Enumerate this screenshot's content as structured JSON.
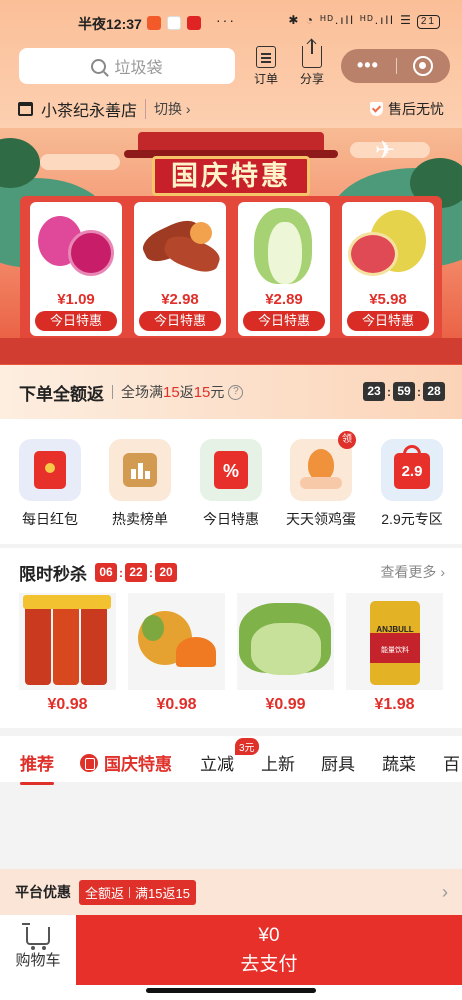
{
  "status": {
    "time": "半夜12:37",
    "dots": "···",
    "sys": "✱ ◔ ᴴᴰ.ıll ᴴᴰ.ıll ☰",
    "battery": "21"
  },
  "header": {
    "search_placeholder": "垃圾袋",
    "orders_label": "订单",
    "share_label": "分享",
    "more_label": "•••"
  },
  "store": {
    "name": "小茶纪永善店",
    "switch_label": "切换 ›",
    "after_sale": "售后无忧"
  },
  "banner": {
    "title": "国庆特惠",
    "deals": [
      {
        "price": "¥1.09",
        "tag": "今日特惠"
      },
      {
        "price": "¥2.98",
        "tag": "今日特惠"
      },
      {
        "price": "¥2.89",
        "tag": "今日特惠"
      },
      {
        "price": "¥5.98",
        "tag": "今日特惠"
      }
    ]
  },
  "promo": {
    "title": "下单全额返",
    "desc_prefix": "全场满",
    "desc_a": "15",
    "desc_mid": "返",
    "desc_b": "15",
    "desc_suffix": "元",
    "help": "?",
    "countdown": [
      "23",
      "59",
      "28"
    ],
    "sep": ":"
  },
  "categories": [
    {
      "label": "每日红包",
      "icon": "red-envelope-icon"
    },
    {
      "label": "热卖榜单",
      "icon": "ranking-icon"
    },
    {
      "label": "今日特惠",
      "icon": "discount-tag-icon"
    },
    {
      "label": "天天领鸡蛋",
      "icon": "egg-icon",
      "badge": "领"
    },
    {
      "label": "2.9元专区",
      "icon": "shopping-bag-icon",
      "icon_text": "2.9"
    }
  ],
  "flash": {
    "title": "限时秒杀",
    "countdown": [
      "06",
      "22",
      "20"
    ],
    "sep": ":",
    "more": "查看更多 ›",
    "items": [
      {
        "price": "¥0.98",
        "name": "spicy-snack-packs"
      },
      {
        "price": "¥0.98",
        "name": "oranges"
      },
      {
        "price": "¥0.99",
        "name": "lettuce"
      },
      {
        "price": "¥1.98",
        "name": "energy-drink",
        "brand": "ANJBULL",
        "brand_cn": "能量饮料"
      }
    ]
  },
  "tabs": [
    {
      "label": "推荐",
      "active": true
    },
    {
      "label": "国庆特惠"
    },
    {
      "label": "立减",
      "badge": "3元"
    },
    {
      "label": "上新"
    },
    {
      "label": "厨具"
    },
    {
      "label": "蔬菜"
    },
    {
      "label": "百"
    }
  ],
  "platform": {
    "title": "平台优惠",
    "pill_a": "全额返",
    "pill_b": "满15返15",
    "chevron": "›"
  },
  "bottom": {
    "cart_label": "购物车",
    "amount": "¥0",
    "pay_label": "去支付"
  },
  "colors": {
    "accent": "#e0302a",
    "header_peach": "#fbbf98"
  }
}
